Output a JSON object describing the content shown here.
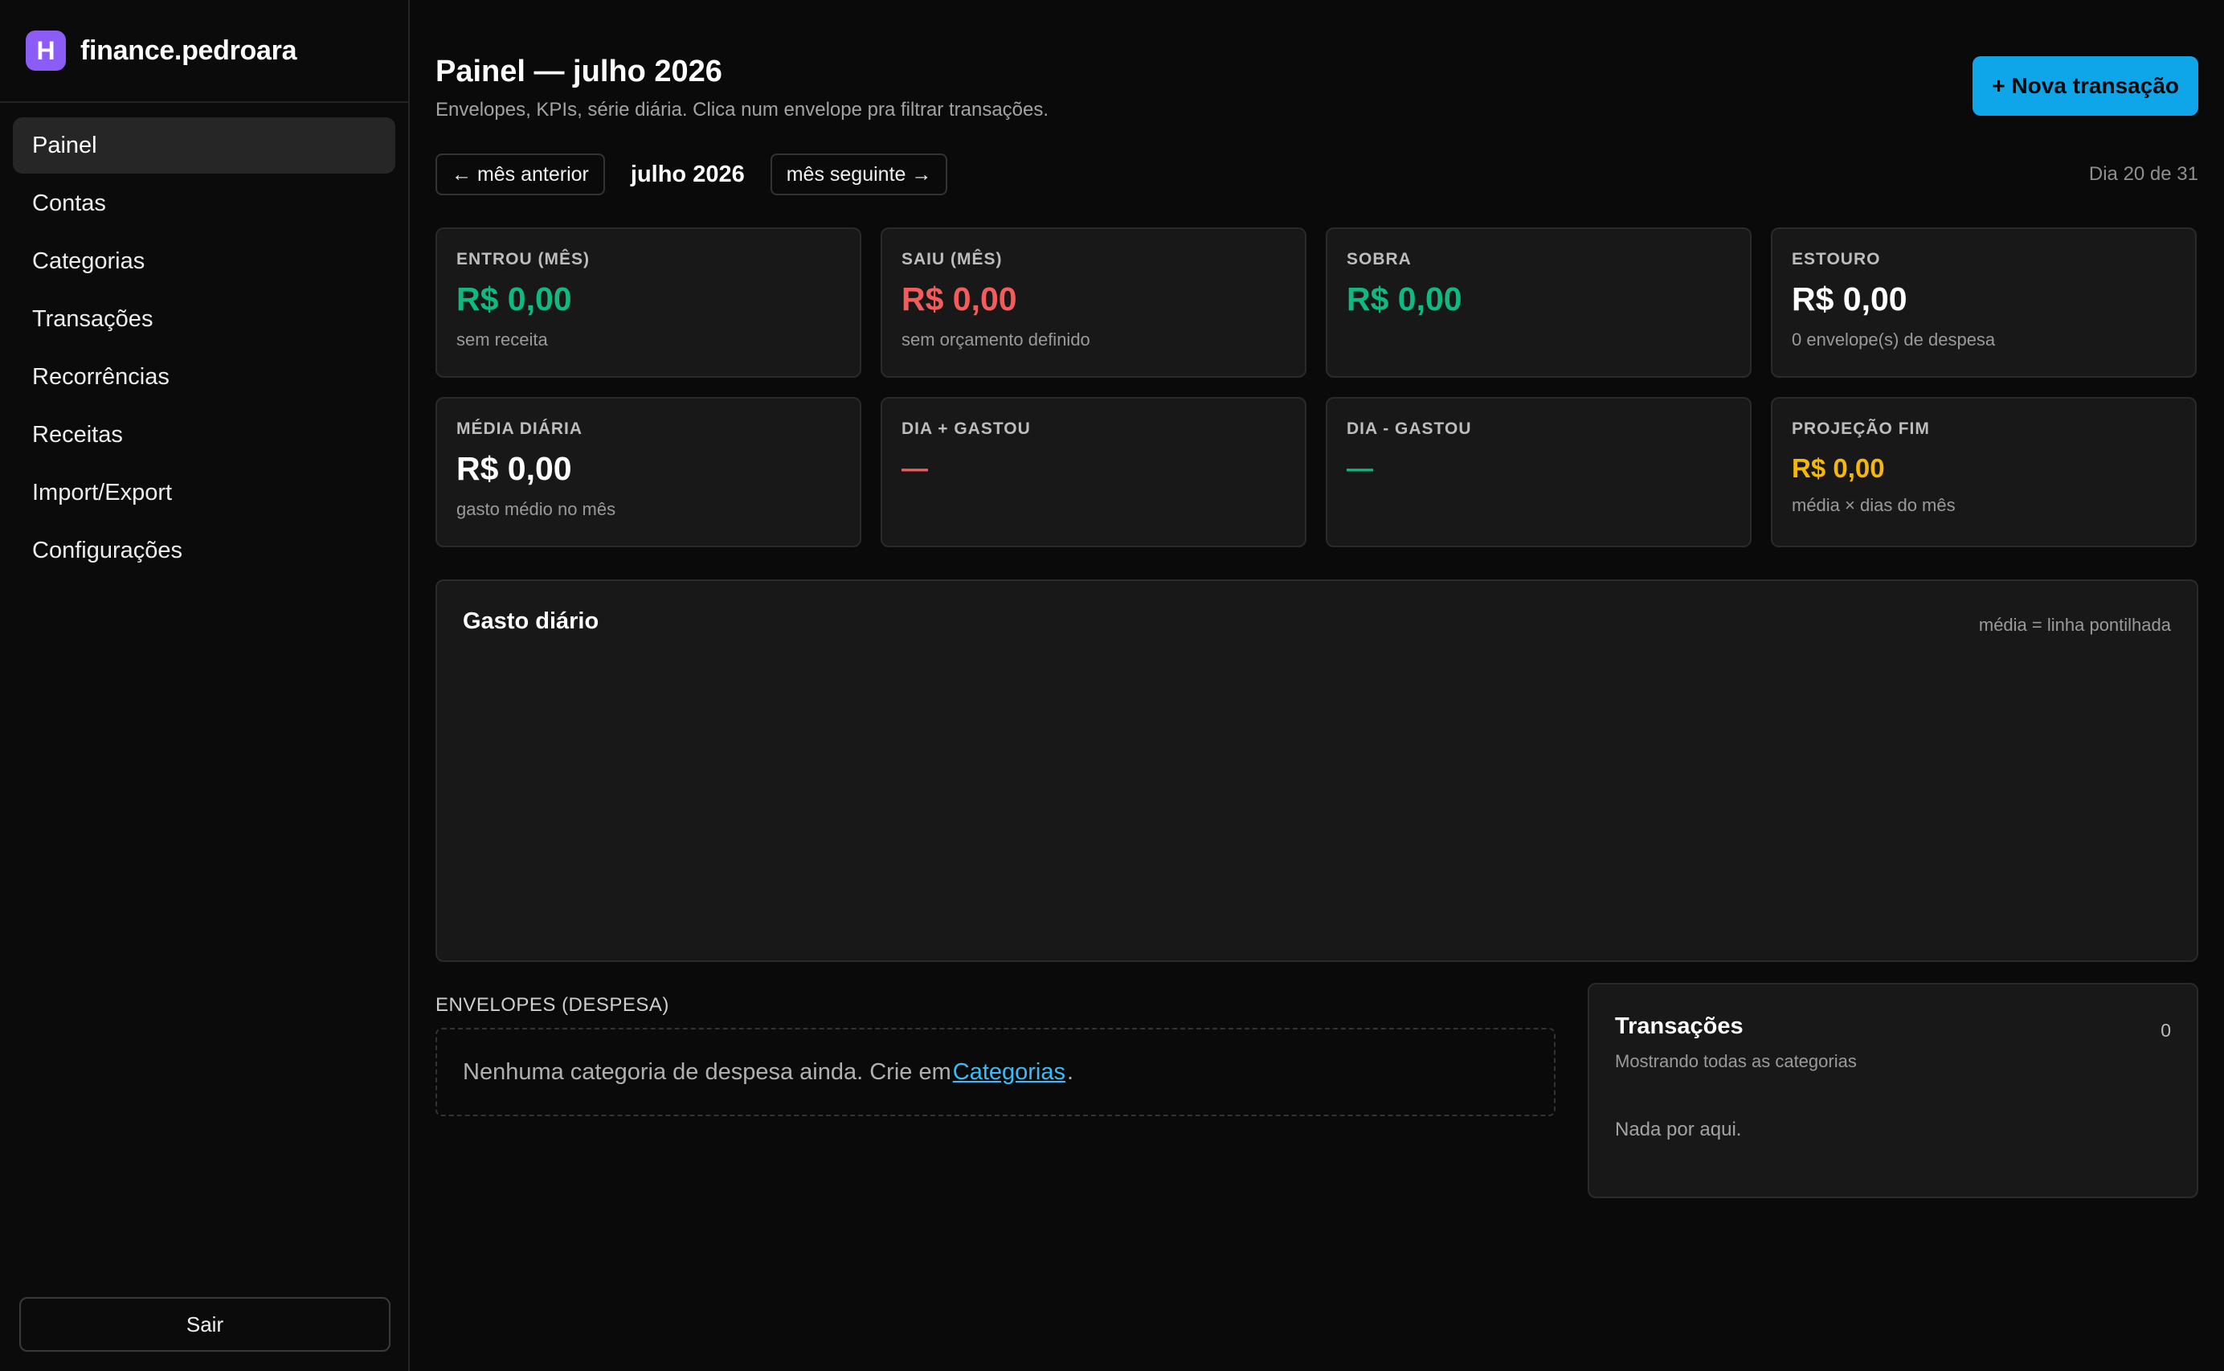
{
  "brand": {
    "logo_letter": "H",
    "name": "finance.pedroara"
  },
  "sidebar": {
    "items": [
      {
        "label": "Painel",
        "active": true
      },
      {
        "label": "Contas"
      },
      {
        "label": "Categorias"
      },
      {
        "label": "Transações"
      },
      {
        "label": "Recorrências"
      },
      {
        "label": "Receitas"
      },
      {
        "label": "Import/Export"
      },
      {
        "label": "Configurações"
      }
    ],
    "logout_label": "Sair"
  },
  "header": {
    "title": "Painel — julho 2026",
    "subtitle": "Envelopes, KPIs, série diária. Clica num envelope pra filtrar transações.",
    "new_transaction_label": "+ Nova transação"
  },
  "month_nav": {
    "prev_label": "← mês anterior",
    "current": "julho 2026",
    "next_label": "mês seguinte →",
    "day_counter": "Dia 20 de 31"
  },
  "kpis": [
    {
      "label": "ENTROU (MÊS)",
      "value": "R$ 0,00",
      "note": "sem receita"
    },
    {
      "label": "SAIU (MÊS)",
      "value": "R$ 0,00",
      "note": "sem orçamento definido"
    },
    {
      "label": "SOBRA",
      "value": "R$ 0,00",
      "note": ""
    },
    {
      "label": "ESTOURO",
      "value": "R$ 0,00",
      "note": "0 envelope(s) de despesa"
    },
    {
      "label": "MÉDIA DIÁRIA",
      "value": "R$ 0,00",
      "note": "gasto médio no mês"
    },
    {
      "label": "DIA + GASTOU",
      "value": "—",
      "note": ""
    },
    {
      "label": "DIA - GASTOU",
      "value": "—",
      "note": ""
    },
    {
      "label": "PROJEÇÃO FIM",
      "value": "R$ 0,00",
      "note": "média × dias do mês"
    }
  ],
  "colors": {
    "positive": "#10b981",
    "negative": "#f25c5c",
    "warning": "#f5b70a",
    "accent": "#0ea5e9",
    "brand": "#8b5cf6"
  },
  "chart": {
    "title": "Gasto diário",
    "legend": "média = linha pontilhada"
  },
  "envelopes": {
    "section_label": "ENVELOPES (DESPESA)",
    "empty_prefix": "Nenhuma categoria de despesa ainda. Crie em ",
    "empty_link": "Categorias",
    "empty_suffix": "."
  },
  "transactions": {
    "title": "Transações",
    "count": "0",
    "subtitle": "Mostrando todas as categorias",
    "empty": "Nada por aqui."
  }
}
